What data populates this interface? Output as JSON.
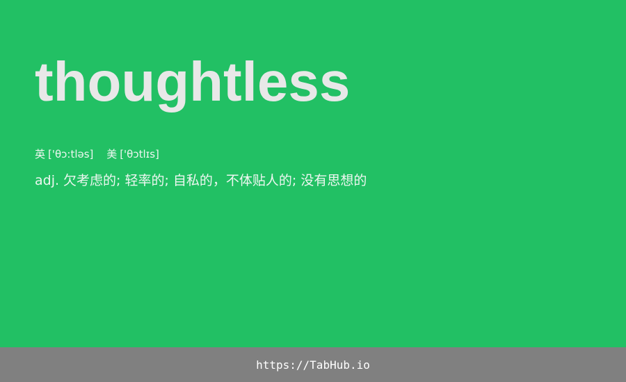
{
  "colors": {
    "background": "#22c064",
    "word": "#e8e8e8",
    "text": "#eef7f1",
    "footer_bg": "#808080",
    "footer_text": "#ffffff"
  },
  "card": {
    "word": "thoughtless",
    "phonetics": {
      "uk_label": "英",
      "uk_ipa": "['θɔ:tləs]",
      "us_label": "美",
      "us_ipa": "['θɔtlɪs]"
    },
    "definition": {
      "pos": "adj.",
      "text": "欠考虑的; 轻率的; 自私的，不体贴人的; 没有思想的"
    }
  },
  "footer": {
    "link_text": "https://TabHub.io"
  }
}
